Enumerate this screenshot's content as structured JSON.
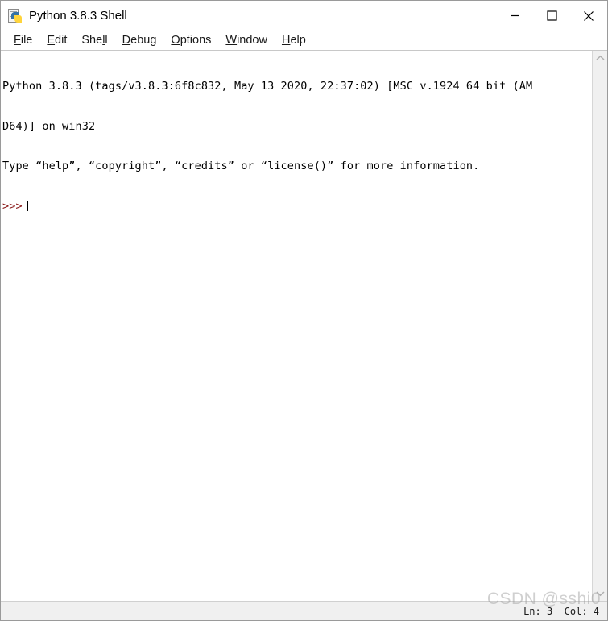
{
  "window": {
    "title": "Python 3.8.3 Shell",
    "icon": "python-idle-icon",
    "controls": {
      "minimize_label": "Minimize",
      "maximize_label": "Maximize",
      "close_label": "Close"
    }
  },
  "menubar": {
    "items": [
      {
        "label": "File",
        "pre": "",
        "acc": "F",
        "post": "ile"
      },
      {
        "label": "Edit",
        "pre": "",
        "acc": "E",
        "post": "dit"
      },
      {
        "label": "Shell",
        "pre": "She",
        "acc": "l",
        "post": "l"
      },
      {
        "label": "Debug",
        "pre": "",
        "acc": "D",
        "post": "ebug"
      },
      {
        "label": "Options",
        "pre": "",
        "acc": "O",
        "post": "ptions"
      },
      {
        "label": "Window",
        "pre": "",
        "acc": "W",
        "post": "indow"
      },
      {
        "label": "Help",
        "pre": "",
        "acc": "H",
        "post": "elp"
      }
    ]
  },
  "console": {
    "lines": [
      "Python 3.8.3 (tags/v3.8.3:6f8c832, May 13 2020, 22:37:02) [MSC v.1924 64 bit (AM",
      "D64)] on win32",
      "Type “help”, “copyright”, “credits” or “license()” for more information."
    ],
    "prompt": ">>>"
  },
  "scrollbar": {
    "up_icon": "chevron-up-icon",
    "down_icon": "chevron-down-icon"
  },
  "statusbar": {
    "position": "Ln: 3  Col: 4"
  },
  "watermark": {
    "text": "CSDN @sshi0"
  }
}
